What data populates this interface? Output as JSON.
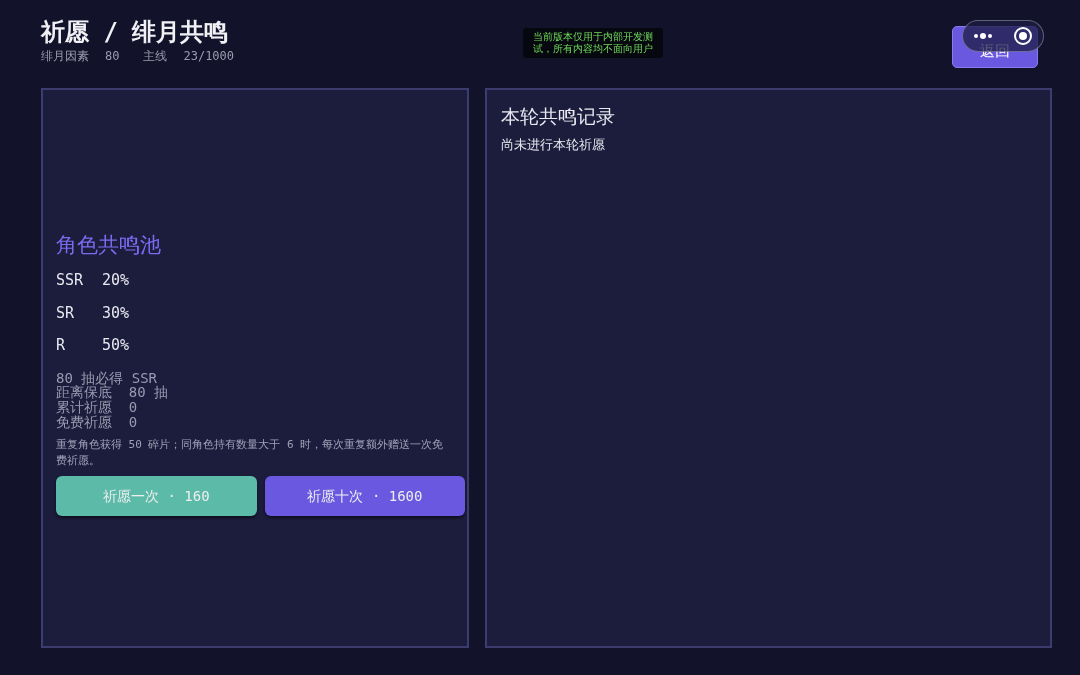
{
  "header": {
    "title": "祈愿 / 绯月共鸣",
    "stats": [
      {
        "label": "绯月因素",
        "value": "80"
      },
      {
        "label": "主线",
        "value": "23/1000"
      }
    ]
  },
  "notice": [
    "当前版本仅用于内部开发测",
    "试，所有内容均不面向用户"
  ],
  "back_button": {
    "label": "返回"
  },
  "pool": {
    "title": "角色共鸣池",
    "rates": [
      {
        "rarity": "SSR",
        "rate": "20%"
      },
      {
        "rarity": "SR",
        "rate": "30%"
      },
      {
        "rarity": "R",
        "rate": "50%"
      }
    ],
    "info": [
      "80 抽必得 SSR",
      "距离保底  80 抽",
      "累计祈愿  0",
      "免费祈愿  0"
    ],
    "note": "重复角色获得 50 碎片；同角色持有数量大于 6 时，每次重复额外赠送一次免费祈愿。",
    "buttons": [
      {
        "label": "祈愿一次 · 160",
        "kind": "single"
      },
      {
        "label": "祈愿十次 · 1600",
        "kind": "multi"
      }
    ]
  },
  "record": {
    "title": "本轮共鸣记录",
    "empty": "尚未进行本轮祈愿"
  }
}
